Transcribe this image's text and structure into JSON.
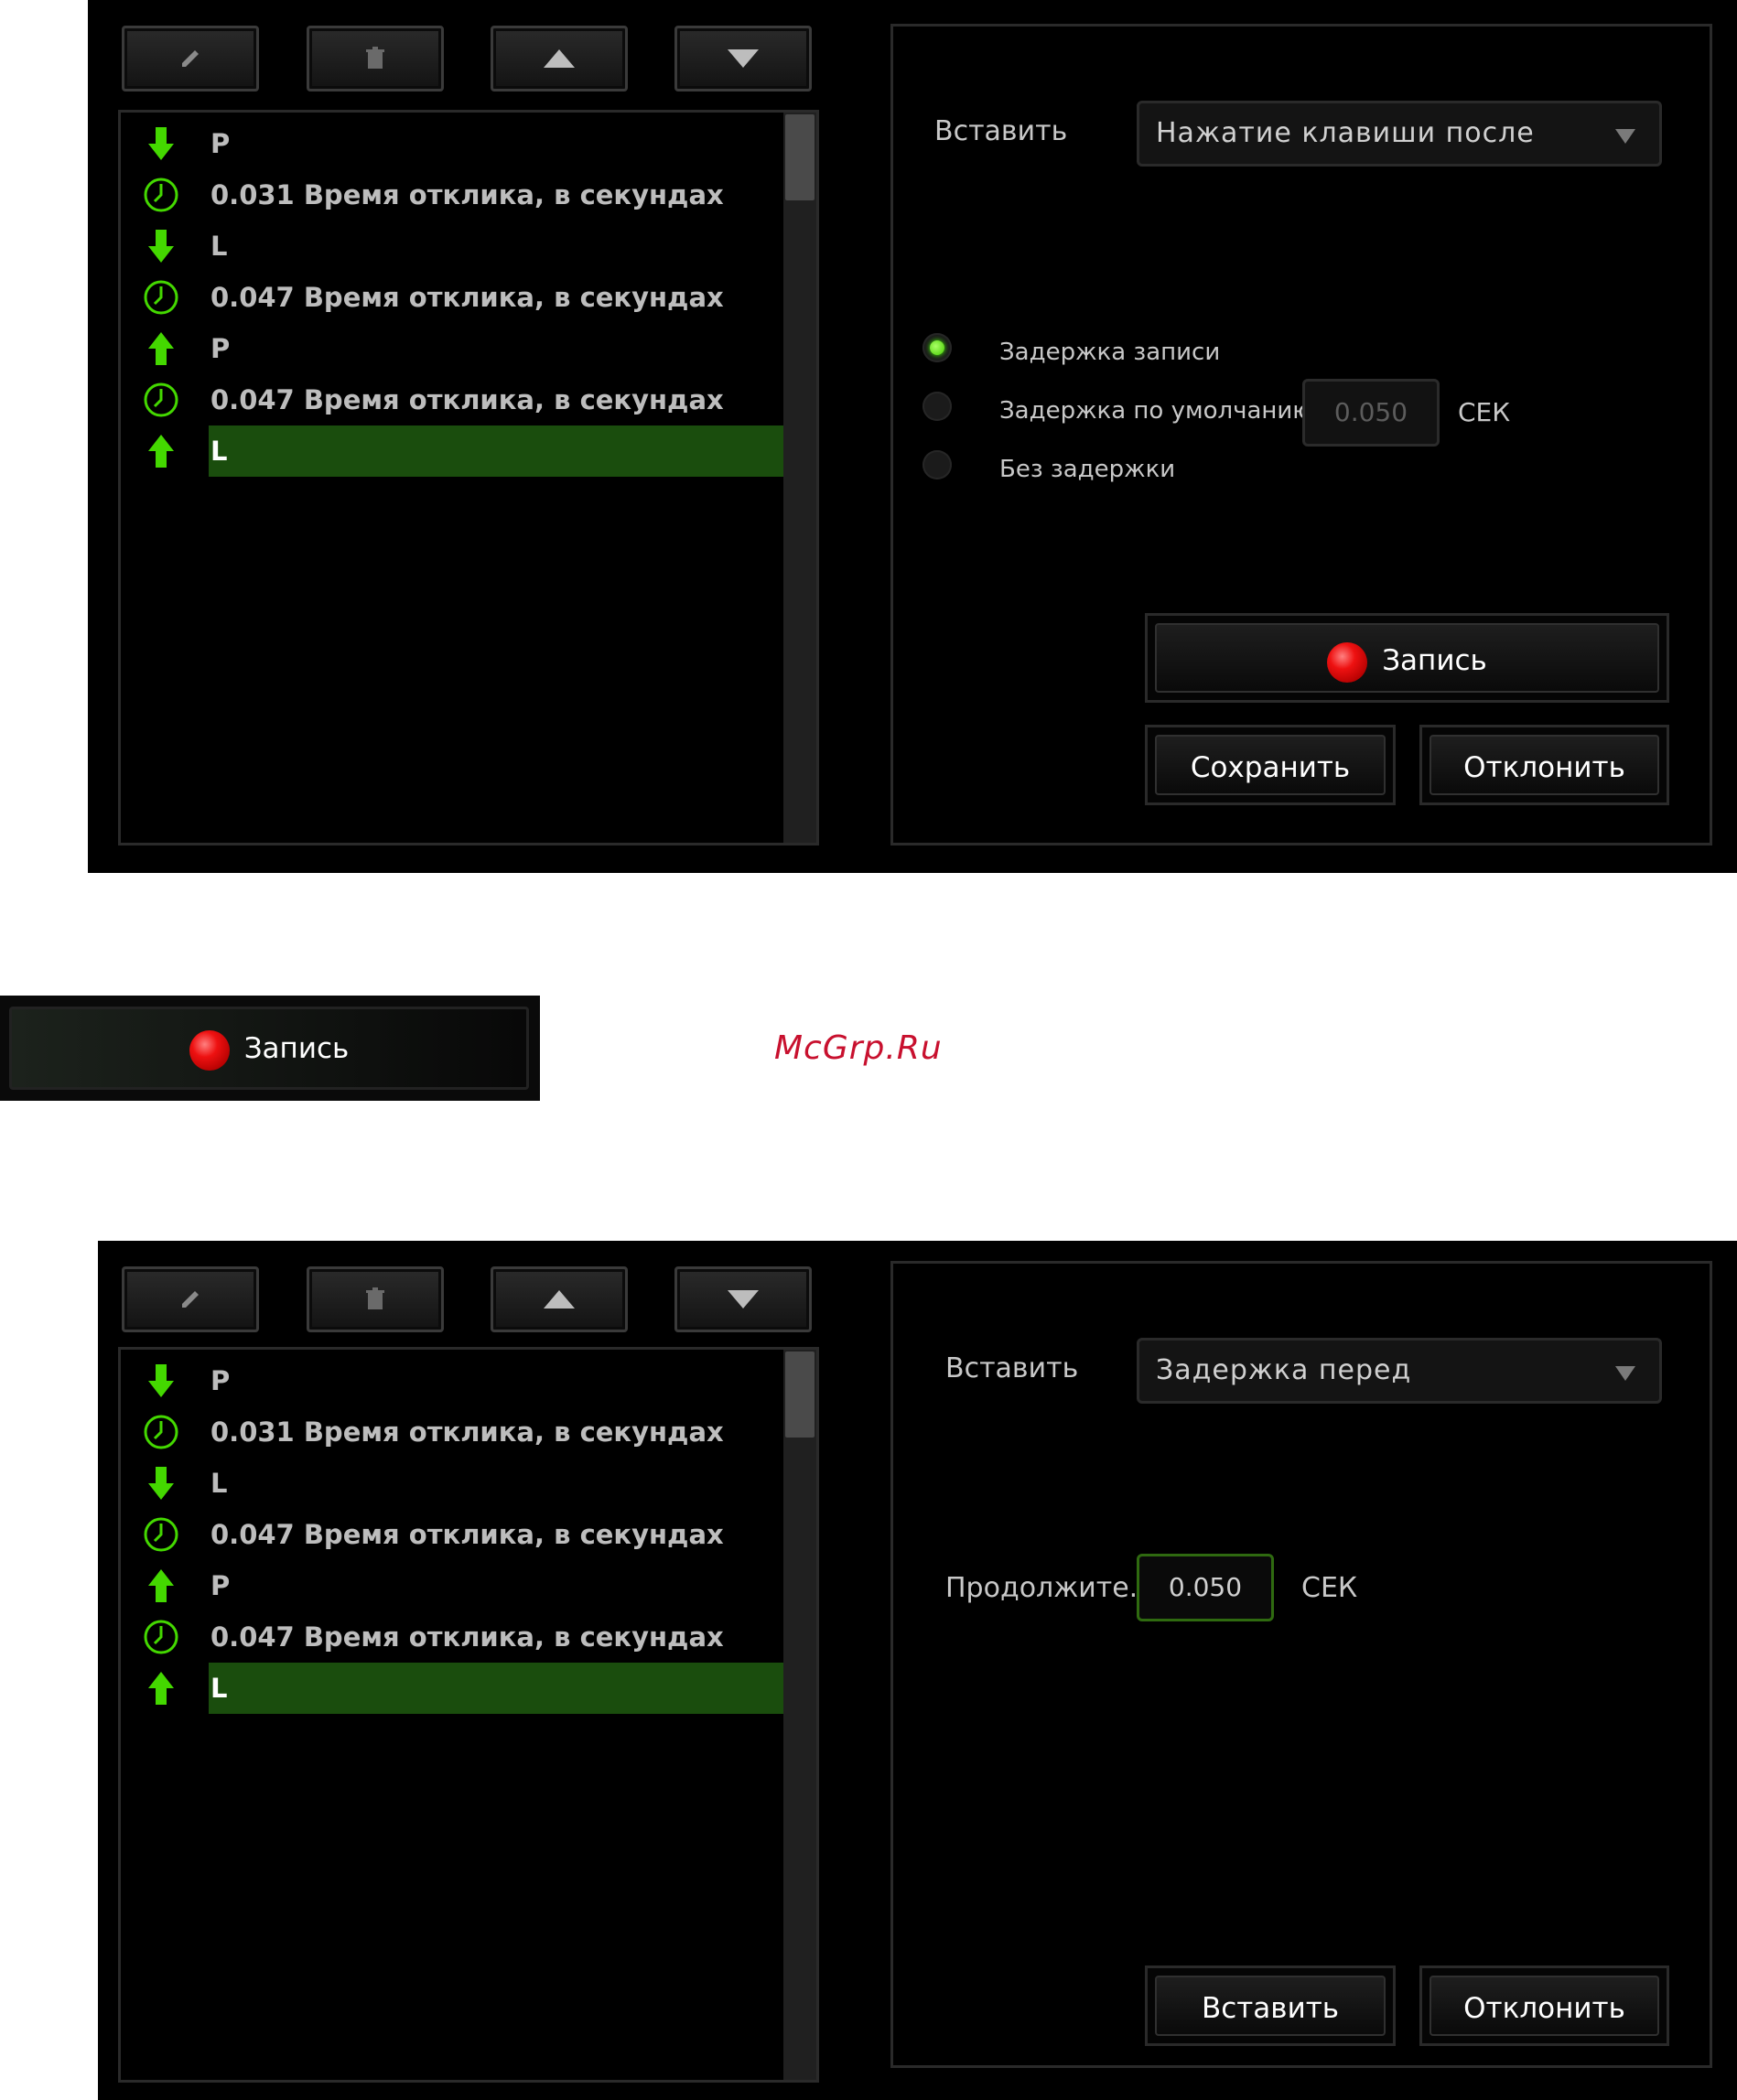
{
  "toolbar": {
    "icons": [
      "pencil-icon",
      "trash-icon",
      "arrow-up-icon",
      "arrow-down-icon"
    ]
  },
  "macro_list": [
    {
      "icon": "key-down-icon",
      "text": "P"
    },
    {
      "icon": "clock-icon",
      "text": "0.031 Время отклика, в секундах"
    },
    {
      "icon": "key-down-icon",
      "text": "L"
    },
    {
      "icon": "clock-icon",
      "text": "0.047 Время отклика, в секундах"
    },
    {
      "icon": "key-up-icon",
      "text": "P"
    },
    {
      "icon": "clock-icon",
      "text": "0.047 Время отклика, в секундах"
    },
    {
      "icon": "key-up-icon",
      "text": "L",
      "selected": true
    }
  ],
  "panel1": {
    "insert_label": "Вставить",
    "insert_value": "Нажатие клавиши после",
    "radio_options": [
      {
        "label": "Задержка записи",
        "checked": true
      },
      {
        "label": "Задержка по умолчанию",
        "checked": false
      },
      {
        "label": "Без задержки",
        "checked": false
      }
    ],
    "default_delay_value": "0.050",
    "unit": "СЕК",
    "record_button": "Запись",
    "save_button": "Сохранить",
    "cancel_button": "Отклонить"
  },
  "standalone_record_button": "Запись",
  "watermark": "McGrp.Ru",
  "panel2": {
    "insert_label": "Вставить",
    "insert_value": "Задержка перед",
    "duration_label": "Продолжите.",
    "duration_value": "0.050",
    "unit": "СЕК",
    "insert_button": "Вставить",
    "cancel_button": "Отклонить"
  },
  "colors": {
    "accent_green": "#44d800",
    "selection_green": "#1a4d0d",
    "record_red": "#e01010",
    "watermark_red": "#c8102e"
  }
}
